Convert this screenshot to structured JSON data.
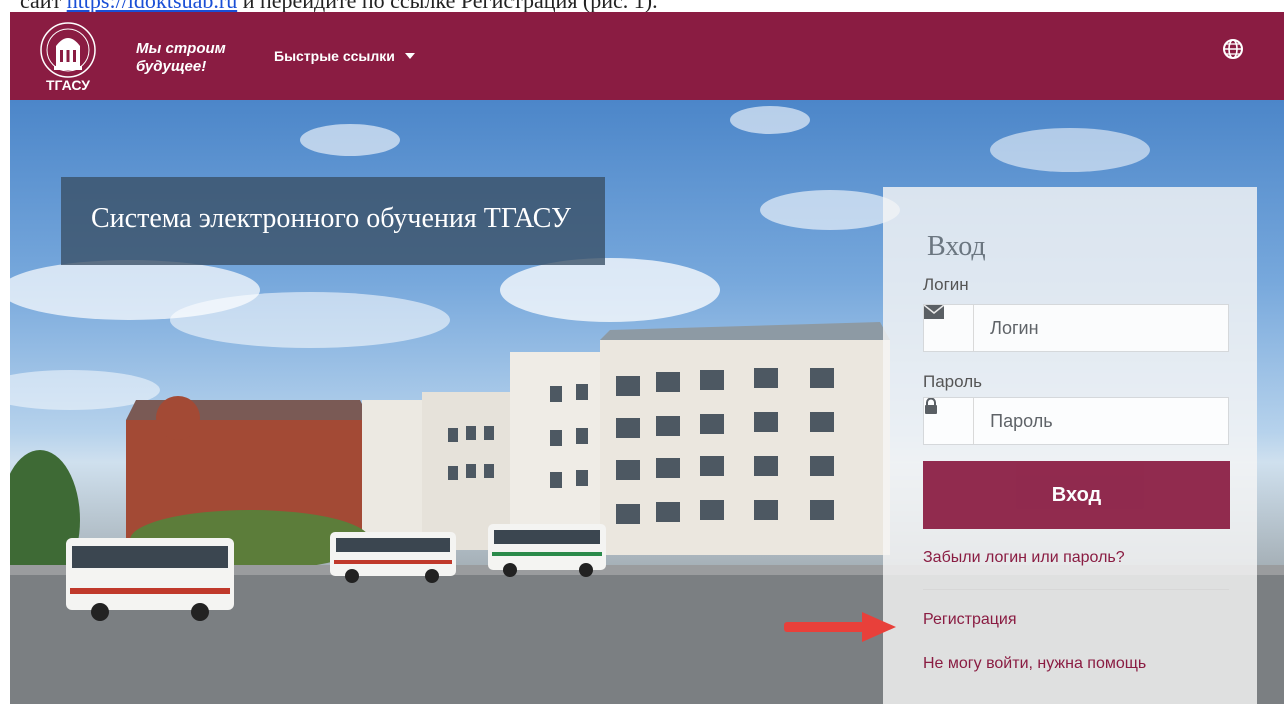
{
  "doc": {
    "line_prefix": "сайт ",
    "link_text": "https://idoktsuab.ru",
    "line_suffix": " и перейдите по ссылке Регистрация (рис. 1)."
  },
  "navbar": {
    "logo_text": "ТГАСУ",
    "slogan_line1": "Мы строим",
    "slogan_line2": "будущее!",
    "quick_links_label": "Быстрые ссылки",
    "bg_color": "#8a1c42"
  },
  "hero": {
    "title": "Система электронного обучения ТГАСУ"
  },
  "login": {
    "heading": "Вход",
    "username_label": "Логин",
    "username_placeholder": "Логин",
    "password_label": "Пароль",
    "password_placeholder": "Пароль",
    "submit_label": "Вход",
    "forgot_link": "Забыли логин или пароль?",
    "register_link": "Регистрация",
    "help_link": "Не могу войти, нужна помощь"
  },
  "colors": {
    "brand": "#8a1c42",
    "arrow": "#e8403a"
  }
}
